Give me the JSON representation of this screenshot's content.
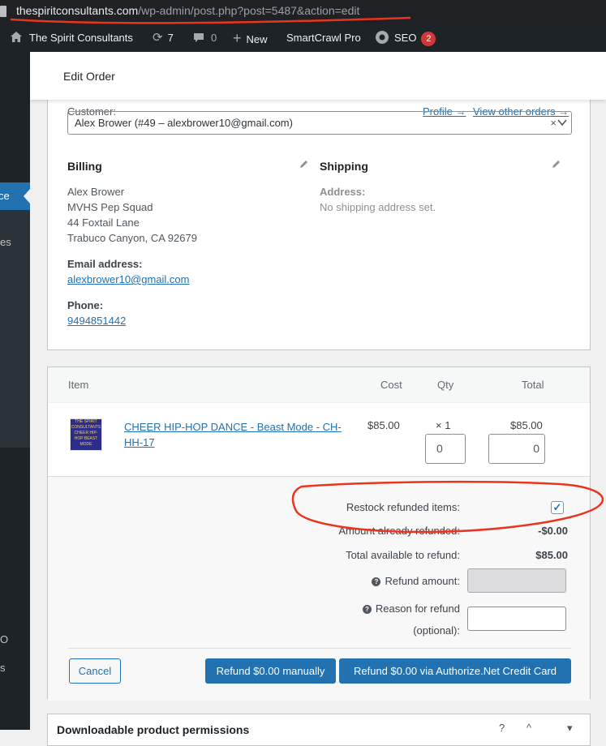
{
  "browser": {
    "url_host": "thespiritconsultants.com",
    "url_path": "/wp-admin/post.php?post=5487&action=edit"
  },
  "adminbar": {
    "site_name": "The Spirit Consultants",
    "updates_count": "7",
    "comments_count": "0",
    "new_label": "New",
    "smartcrawl_label": "SmartCrawl Pro",
    "seo_label": "SEO",
    "seo_badge": "2"
  },
  "sidebar": {
    "active_fragment": "ce",
    "fragment_1": "es",
    "fragment_2": "O",
    "fragment_3": "s"
  },
  "header": {
    "title": "Edit Order"
  },
  "customer": {
    "label": "Customer:",
    "profile_link": "Profile →",
    "other_orders_link": "View other orders →",
    "selected": "Alex Brower (#49 – alexbrower10@gmail.com)",
    "clear_glyph": "×"
  },
  "billing": {
    "heading": "Billing",
    "name": "Alex Brower",
    "company": "MVHS Pep Squad",
    "street": "44 Foxtail Lane",
    "city_line": "Trabuco Canyon, CA 92679",
    "email_label": "Email address:",
    "email": "alexbrower10@gmail.com",
    "phone_label": "Phone:",
    "phone": "9494851442"
  },
  "shipping": {
    "heading": "Shipping",
    "address_label": "Address:",
    "address_value": "No shipping address set."
  },
  "items": {
    "headers": {
      "item": "Item",
      "cost": "Cost",
      "qty": "Qty",
      "total": "Total"
    },
    "rows": [
      {
        "name": "CHEER HIP-HOP DANCE - Beast Mode - CH-HH-17",
        "thumb_text": "THE SPIRIT CONSULTANTS CHEER HIP-HOP BEAST MODE",
        "cost": "$85.00",
        "qty": "× 1",
        "total": "$85.00",
        "refund_qty": "0",
        "refund_total": "0"
      }
    ]
  },
  "refund": {
    "restock_label": "Restock refunded items:",
    "restock_checked": true,
    "already_refunded_label": "Amount already refunded:",
    "already_refunded_value": "-$0.00",
    "available_label": "Total available to refund:",
    "available_value": "$85.00",
    "amount_label": "Refund amount:",
    "amount_value": "",
    "reason_label_1": "Reason for refund",
    "reason_label_2": "(optional):",
    "reason_value": "",
    "cancel_button": "Cancel",
    "manual_button": "Refund $0.00 manually",
    "gateway_button": "Refund $0.00 via Authorize.Net Credit Card"
  },
  "downloads": {
    "title": "Downloadable product permissions"
  },
  "colors": {
    "annotation": "#e8351f",
    "accent": "#2271b1",
    "adminbar": "#1d2327"
  }
}
